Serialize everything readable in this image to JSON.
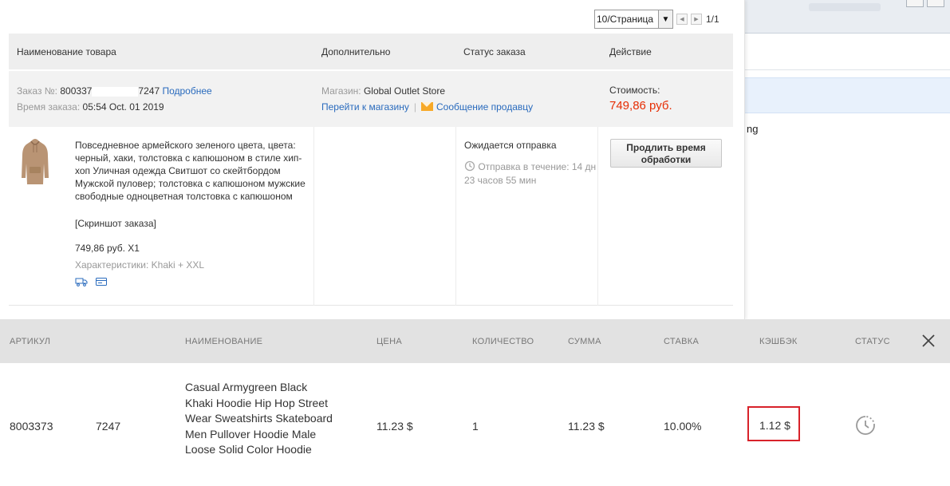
{
  "pager": {
    "per_page": "10/Страница",
    "page_count": "1/1"
  },
  "table": {
    "headers": [
      "Наименование товара",
      "Дополнительно",
      "Статус заказа",
      "Действие"
    ]
  },
  "order": {
    "number_label": "Заказ №:",
    "number_start": "800337",
    "number_end": "7247",
    "details_link": "Подробнее",
    "time_label": "Время заказа:",
    "time_value": "05:54 Oct. 01 2019",
    "store_label": "Магазин:",
    "store_name": "Global Outlet Store",
    "store_link": "Перейти к магазину",
    "message_link": "Сообщение продавцу",
    "cost_label": "Стоимость:",
    "cost_value": "749,86 руб."
  },
  "item": {
    "description": "Повседневное армейского зеленого цвета, цвета: черный, хаки, толстовка с капюшоном в стиле хип-хоп Уличная одежда Свитшот со скейтбордом Мужской пуловер; толстовка с капюшоном мужские свободные одноцветная толстовка с капюшоном",
    "screenshot_link": "[Скриншот заказа]",
    "price_qty": "749,86 руб. X1",
    "characteristics": "Характеристики: Khaki + XXL",
    "status": "Ожидается отправка",
    "shipping_time": "Отправка в течение: 14 дн 23 часов 55 мин",
    "action_button": "Продлить время обработки"
  },
  "cashback": {
    "headers": [
      "АРТИКУЛ",
      "НАИМЕНОВАНИЕ",
      "ЦЕНА",
      "КОЛИЧЕСТВО",
      "СУММА",
      "СТАВКА",
      "КЭШБЭК",
      "СТАТУС"
    ],
    "row": {
      "article": "8003373",
      "article_suffix": "7247",
      "name": "Casual Armygreen Black Khaki Hoodie Hip Hop Street Wear Sweatshirts Skateboard Men Pullover Hoodie Male Loose Solid Color Hoodie",
      "price": "11.23 $",
      "quantity": "1",
      "sum": "11.23 $",
      "rate": "10.00%",
      "cashback": "1.12 $"
    }
  },
  "background": {
    "text_fragment": "ng"
  },
  "colors": {
    "link": "#2a6bbd",
    "price_red": "#e62e04",
    "highlight_border": "#d8222a",
    "header_gray": "#e2e2e2"
  }
}
